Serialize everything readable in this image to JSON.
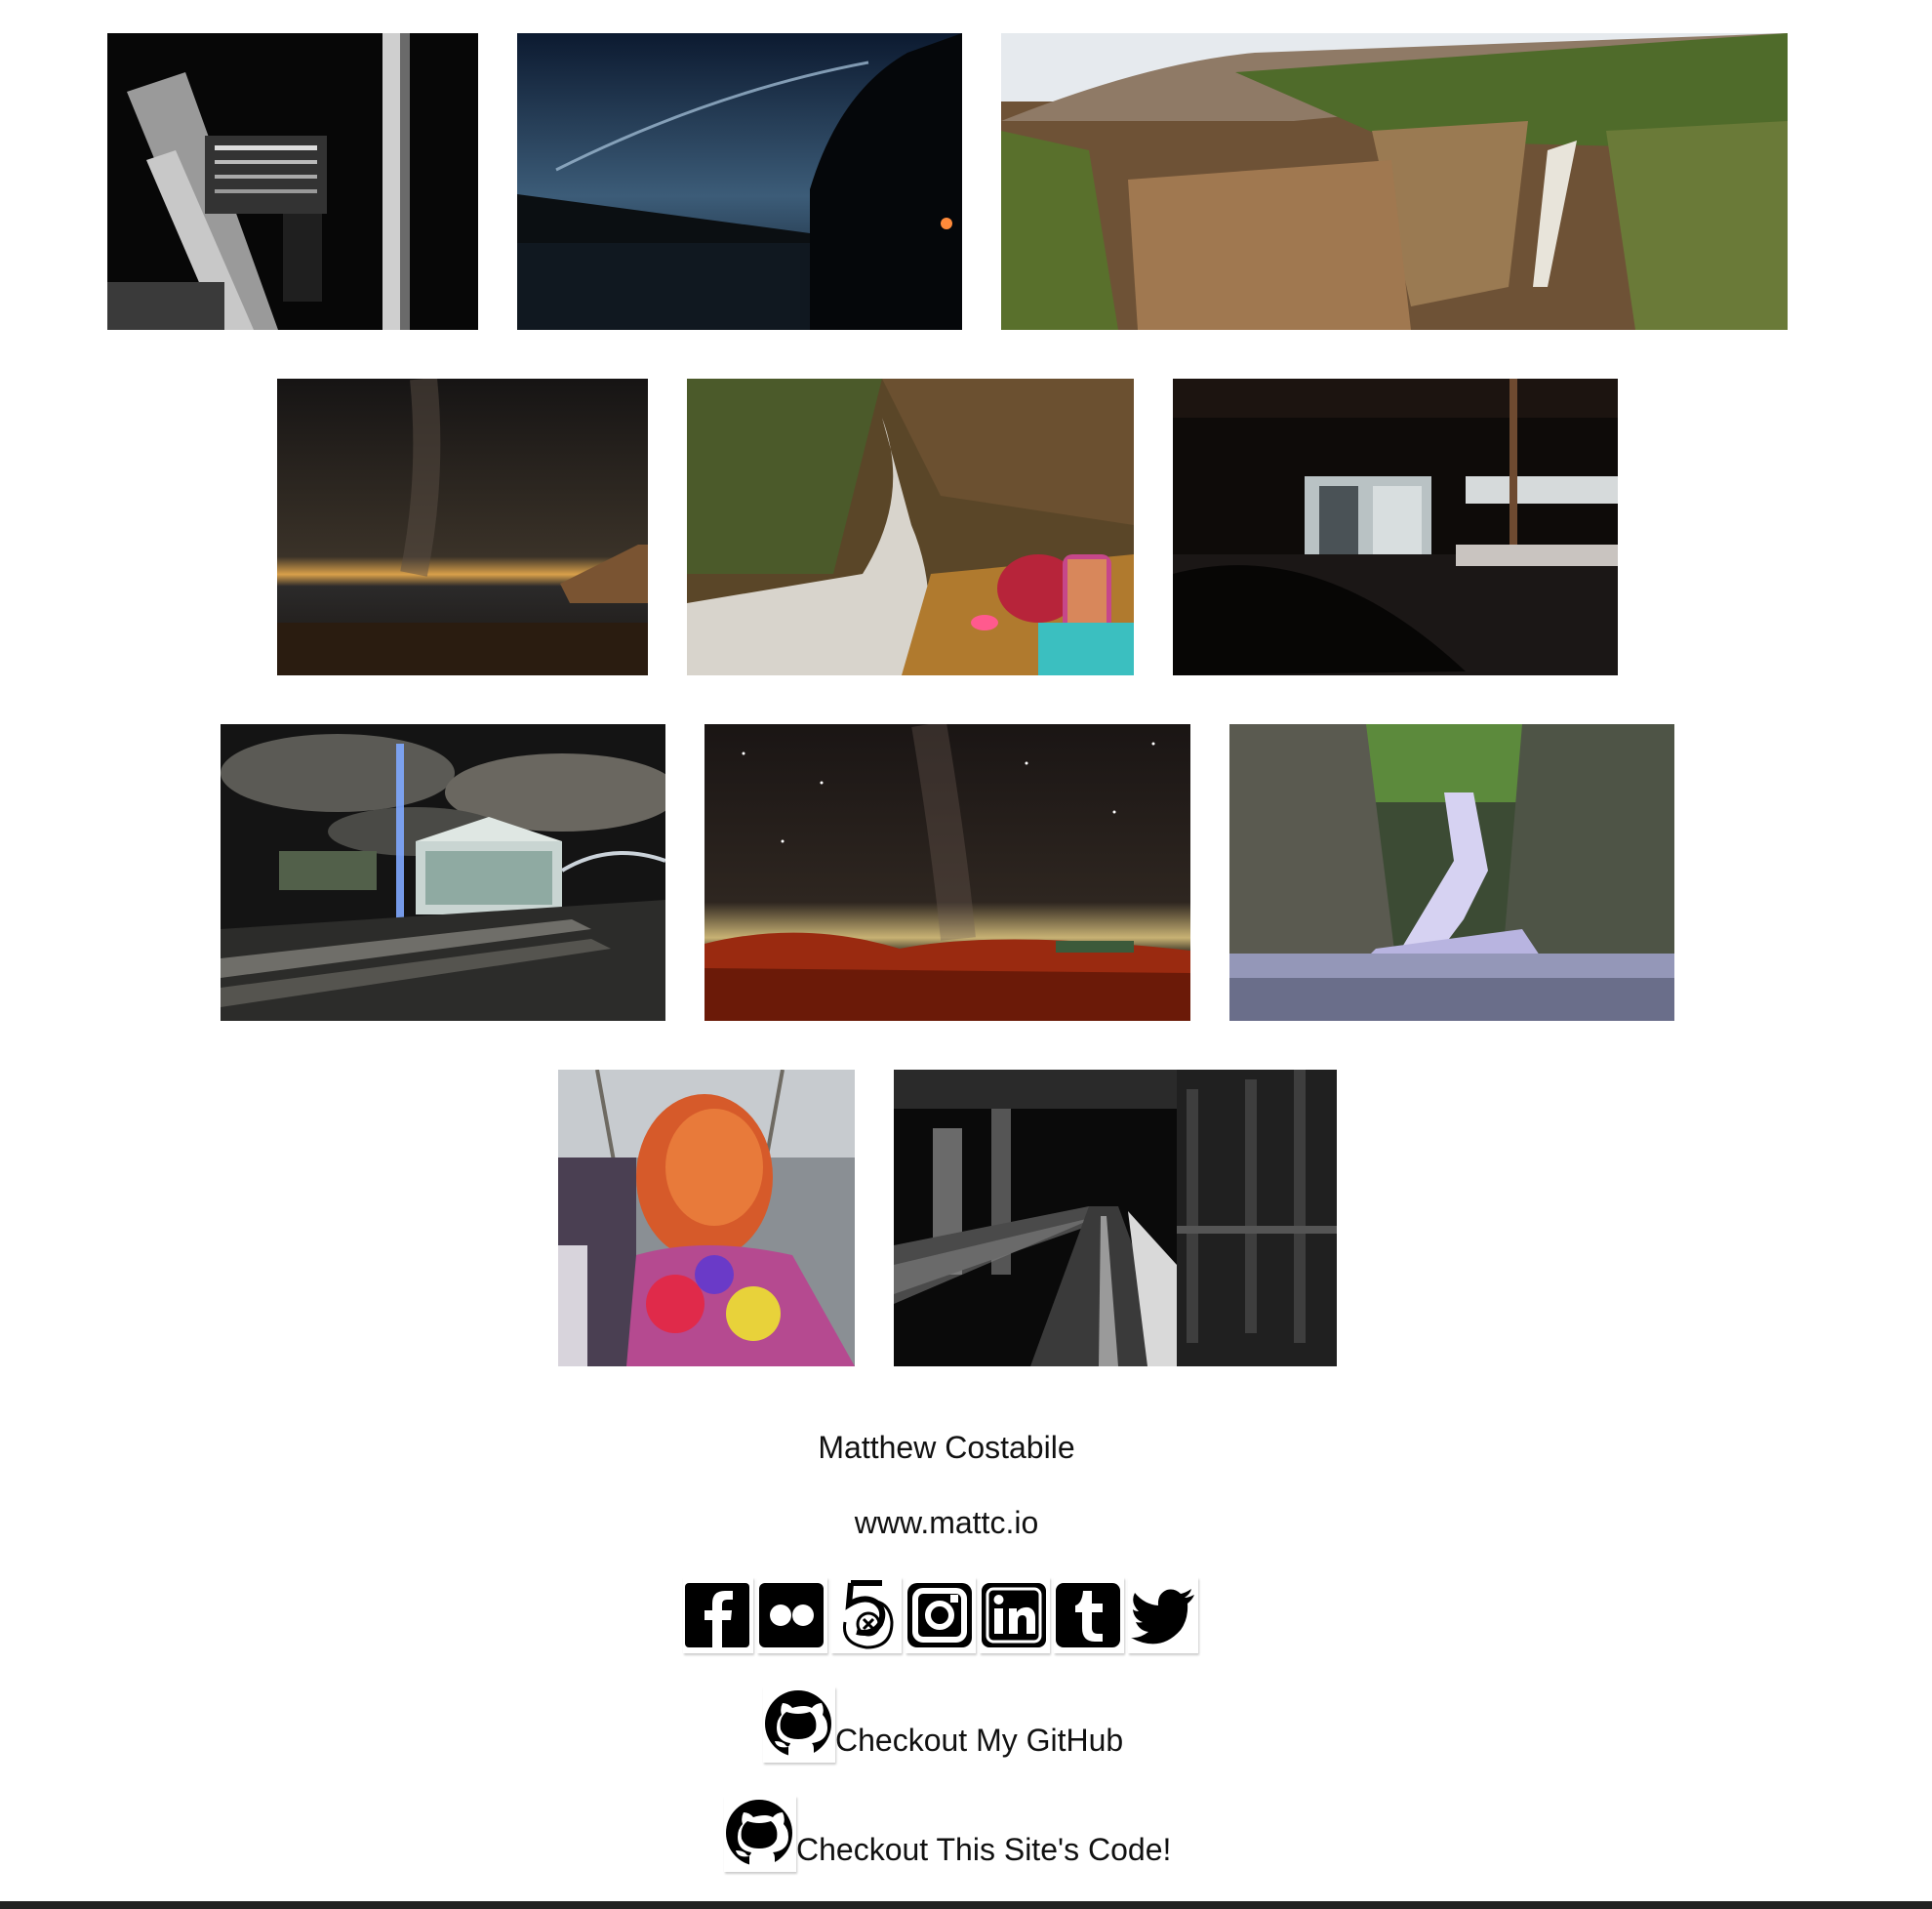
{
  "gallery": {
    "photos": [
      {
        "name": "gallery-photo-building-reflection",
        "subject": "black and white reflection of a building in a puddle"
      },
      {
        "name": "gallery-photo-lake-night-sky",
        "subject": "night sky over a lake with a streak of light"
      },
      {
        "name": "gallery-photo-waterfall-gorge",
        "subject": "panorama of a gorge with a waterfall in autumn"
      },
      {
        "name": "gallery-photo-milky-way-pier",
        "subject": "milky way over water with a wooden pier"
      },
      {
        "name": "gallery-photo-person-by-stream",
        "subject": "person in colorful clothes sitting by a rushing stream"
      },
      {
        "name": "gallery-photo-warehouse-night",
        "subject": "dark warehouse with a lit doorway"
      },
      {
        "name": "gallery-photo-carousel-bridge",
        "subject": "glass carousel pavilion by a bridge under light beams"
      },
      {
        "name": "gallery-photo-milky-way-field",
        "subject": "milky way over a red lit field"
      },
      {
        "name": "gallery-photo-cascade-pool",
        "subject": "cascading waterfall into a pool in the forest"
      },
      {
        "name": "gallery-photo-color-festival",
        "subject": "person with red hair covered in festival color powder"
      },
      {
        "name": "gallery-photo-snowy-walkway",
        "subject": "black and white snowy walkway at night"
      }
    ]
  },
  "footer": {
    "name": "Matthew Costabile",
    "website": "www.mattc.io",
    "social_icons": [
      "facebook-icon",
      "flickr-icon",
      "500px-icon",
      "instagram-icon",
      "linkedin-icon",
      "tumblr-icon",
      "twitter-icon"
    ],
    "github_label": "Checkout My GitHub",
    "site_code_label": "Checkout This Site's Code!"
  }
}
